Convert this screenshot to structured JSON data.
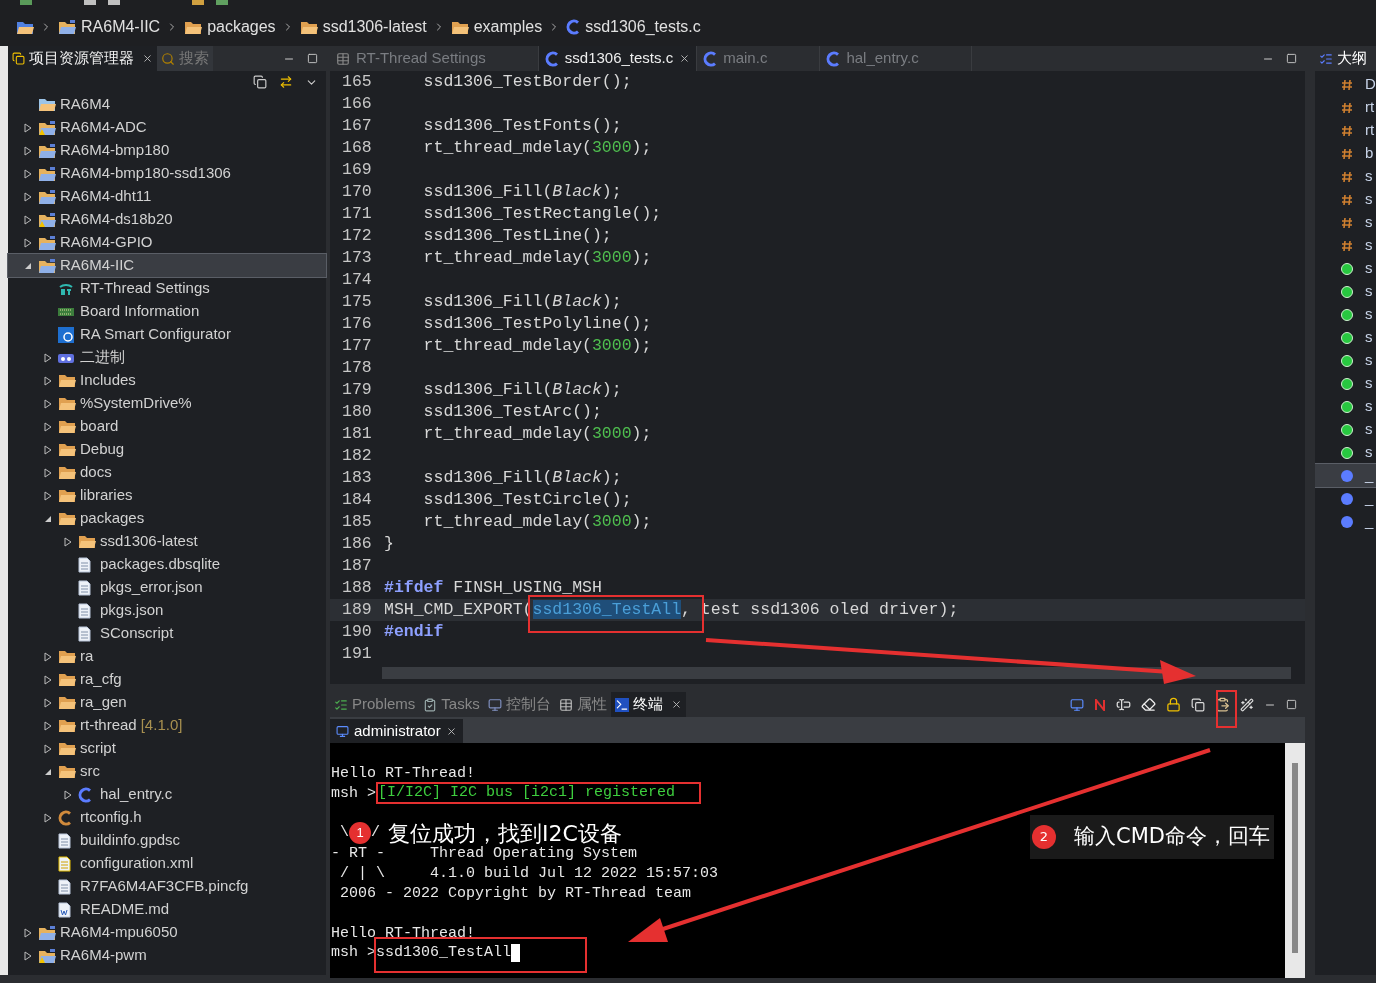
{
  "breadcrumb": [
    {
      "kind": "project",
      "text": "RA6M4-IIC"
    },
    {
      "kind": "folder",
      "text": "packages"
    },
    {
      "kind": "folder",
      "text": "ssd1306-latest"
    },
    {
      "kind": "folder",
      "text": "examples"
    },
    {
      "kind": "c-source",
      "text": "ssd1306_tests.c"
    }
  ],
  "explorer": {
    "tabs": [
      {
        "label": "项目资源管理器",
        "selected": true
      },
      {
        "label": "搜索",
        "selected": false
      }
    ],
    "tree": [
      {
        "kind": "folder-plain",
        "text": "RA6M4",
        "selected": false
      },
      {
        "kind": "project-warning",
        "text": "RA6M4-ADC",
        "expanded": false,
        "selected": false
      },
      {
        "kind": "project",
        "text": "RA6M4-bmp180",
        "expanded": false,
        "selected": false
      },
      {
        "kind": "project",
        "text": "RA6M4-bmp180-ssd1306",
        "expanded": false,
        "selected": false
      },
      {
        "kind": "project",
        "text": "RA6M4-dht11",
        "expanded": false,
        "selected": false
      },
      {
        "kind": "project-warning",
        "text": "RA6M4-ds18b20",
        "expanded": false,
        "selected": false
      },
      {
        "kind": "project",
        "text": "RA6M4-GPIO",
        "expanded": false,
        "selected": false
      },
      {
        "kind": "project",
        "text": "RA6M4-IIC",
        "expanded": true,
        "selected": true,
        "children": [
          {
            "kind": "rt-settings",
            "text": "RT-Thread Settings",
            "selected": false
          },
          {
            "kind": "board-info",
            "text": "Board Information",
            "selected": false
          },
          {
            "kind": "ra-config",
            "text": "RA Smart Configurator",
            "selected": false
          },
          {
            "kind": "binary",
            "text": "二进制",
            "expanded": false,
            "selected": false
          },
          {
            "kind": "includes",
            "text": "Includes",
            "expanded": false,
            "selected": false
          },
          {
            "kind": "folder",
            "text": "%SystemDrive%",
            "expanded": false,
            "selected": false
          },
          {
            "kind": "folder",
            "text": "board",
            "expanded": false,
            "selected": false
          },
          {
            "kind": "folder",
            "text": "Debug",
            "expanded": false,
            "selected": false
          },
          {
            "kind": "folder",
            "text": "docs",
            "expanded": false,
            "selected": false
          },
          {
            "kind": "folder",
            "text": "libraries",
            "expanded": false,
            "selected": false
          },
          {
            "kind": "folder",
            "text": "packages",
            "expanded": true,
            "selected": false,
            "children": [
              {
                "kind": "folder",
                "text": "ssd1306-latest",
                "expanded": false,
                "selected": false
              },
              {
                "kind": "file",
                "text": "packages.dbsqlite",
                "selected": false
              },
              {
                "kind": "file",
                "text": "pkgs_error.json",
                "selected": false
              },
              {
                "kind": "file",
                "text": "pkgs.json",
                "selected": false
              },
              {
                "kind": "file",
                "text": "SConscript",
                "selected": false
              }
            ]
          },
          {
            "kind": "folder",
            "text": "ra",
            "expanded": false,
            "selected": false
          },
          {
            "kind": "folder",
            "text": "ra_cfg",
            "expanded": false,
            "selected": false
          },
          {
            "kind": "folder",
            "text": "ra_gen",
            "expanded": false,
            "selected": false
          },
          {
            "kind": "folder",
            "text": "rt-thread",
            "suffix": "[4.1.0]",
            "expanded": false,
            "selected": false
          },
          {
            "kind": "folder",
            "text": "script",
            "expanded": false,
            "selected": false
          },
          {
            "kind": "folder",
            "text": "src",
            "expanded": true,
            "selected": false,
            "children": [
              {
                "kind": "c-source",
                "text": "hal_entry.c",
                "expanded": false,
                "selected": false
              }
            ]
          },
          {
            "kind": "c-header",
            "text": "rtconfig.h",
            "expanded": false,
            "selected": false
          },
          {
            "kind": "file",
            "text": "buildinfo.gpdsc",
            "selected": false
          },
          {
            "kind": "xml",
            "text": "configuration.xml",
            "selected": false
          },
          {
            "kind": "file",
            "text": "R7FA6M4AF3CFB.pincfg",
            "selected": false
          },
          {
            "kind": "word-doc",
            "text": "README.md",
            "selected": false
          }
        ]
      },
      {
        "kind": "project",
        "text": "RA6M4-mpu6050",
        "expanded": false,
        "selected": false
      },
      {
        "kind": "project-warning",
        "text": "RA6M4-pwm",
        "expanded": false,
        "selected": false
      }
    ]
  },
  "editor": {
    "tabs": [
      {
        "kind": "settings",
        "label": "RT-Thread Settings",
        "selected": false
      },
      {
        "kind": "c-source",
        "label": "ssd1306_tests.c",
        "selected": true
      },
      {
        "kind": "c-source",
        "label": "main.c",
        "selected": false
      },
      {
        "kind": "c-source",
        "label": "hal_entry.c",
        "selected": false
      }
    ],
    "lines": [
      {
        "num": "165",
        "current": false,
        "tokens": [
          {
            "kind": "plain",
            "text": "    ssd1306_TestBorder();"
          }
        ]
      },
      {
        "num": "166",
        "current": false
      },
      {
        "num": "167",
        "current": false,
        "tokens": [
          {
            "kind": "plain",
            "text": "    ssd1306_TestFonts();"
          }
        ]
      },
      {
        "num": "168",
        "current": false,
        "tokens": [
          {
            "kind": "plain",
            "text": "    rt_thread_mdelay("
          },
          {
            "kind": "number",
            "text": "3000"
          },
          {
            "kind": "plain",
            "text": ");"
          }
        ]
      },
      {
        "num": "169",
        "current": false
      },
      {
        "num": "170",
        "current": false,
        "tokens": [
          {
            "kind": "plain",
            "text": "    ssd1306_Fill("
          },
          {
            "kind": "constant",
            "text": "Black"
          },
          {
            "kind": "plain",
            "text": ");"
          }
        ]
      },
      {
        "num": "171",
        "current": false,
        "tokens": [
          {
            "kind": "plain",
            "text": "    ssd1306_TestRectangle();"
          }
        ]
      },
      {
        "num": "172",
        "current": false,
        "tokens": [
          {
            "kind": "plain",
            "text": "    ssd1306_TestLine();"
          }
        ]
      },
      {
        "num": "173",
        "current": false,
        "tokens": [
          {
            "kind": "plain",
            "text": "    rt_thread_mdelay("
          },
          {
            "kind": "number",
            "text": "3000"
          },
          {
            "kind": "plain",
            "text": ");"
          }
        ]
      },
      {
        "num": "174",
        "current": false
      },
      {
        "num": "175",
        "current": false,
        "tokens": [
          {
            "kind": "plain",
            "text": "    ssd1306_Fill("
          },
          {
            "kind": "constant",
            "text": "Black"
          },
          {
            "kind": "plain",
            "text": ");"
          }
        ]
      },
      {
        "num": "176",
        "current": false,
        "tokens": [
          {
            "kind": "plain",
            "text": "    ssd1306_TestPolyline();"
          }
        ]
      },
      {
        "num": "177",
        "current": false,
        "tokens": [
          {
            "kind": "plain",
            "text": "    rt_thread_mdelay("
          },
          {
            "kind": "number",
            "text": "3000"
          },
          {
            "kind": "plain",
            "text": ");"
          }
        ]
      },
      {
        "num": "178",
        "current": false
      },
      {
        "num": "179",
        "current": false,
        "tokens": [
          {
            "kind": "plain",
            "text": "    ssd1306_Fill("
          },
          {
            "kind": "constant",
            "text": "Black"
          },
          {
            "kind": "plain",
            "text": ");"
          }
        ]
      },
      {
        "num": "180",
        "current": false,
        "tokens": [
          {
            "kind": "plain",
            "text": "    ssd1306_TestArc();"
          }
        ]
      },
      {
        "num": "181",
        "current": false,
        "tokens": [
          {
            "kind": "plain",
            "text": "    rt_thread_mdelay("
          },
          {
            "kind": "number",
            "text": "3000"
          },
          {
            "kind": "plain",
            "text": ");"
          }
        ]
      },
      {
        "num": "182",
        "current": false
      },
      {
        "num": "183",
        "current": false,
        "tokens": [
          {
            "kind": "plain",
            "text": "    ssd1306_Fill("
          },
          {
            "kind": "constant",
            "text": "Black"
          },
          {
            "kind": "plain",
            "text": ");"
          }
        ]
      },
      {
        "num": "184",
        "current": false,
        "tokens": [
          {
            "kind": "plain",
            "text": "    ssd1306_TestCircle();"
          }
        ]
      },
      {
        "num": "185",
        "current": false,
        "tokens": [
          {
            "kind": "plain",
            "text": "    rt_thread_mdelay("
          },
          {
            "kind": "number",
            "text": "3000"
          },
          {
            "kind": "plain",
            "text": ");"
          }
        ]
      },
      {
        "num": "186",
        "current": false,
        "tokens": [
          {
            "kind": "plain",
            "text": "}"
          }
        ]
      },
      {
        "num": "187",
        "current": false
      },
      {
        "num": "188",
        "current": false,
        "tokens": [
          {
            "kind": "keyword",
            "text": "#ifdef"
          },
          {
            "kind": "plain",
            "text": " FINSH_USING_MSH"
          }
        ]
      },
      {
        "num": "189",
        "current": true,
        "tokens": [
          {
            "kind": "plain",
            "text": "MSH_CMD_EXPORT("
          },
          {
            "kind": "selection",
            "text": "ssd1306_TestAll"
          },
          {
            "kind": "plain",
            "text": ", test ssd1306 oled driver);"
          }
        ]
      },
      {
        "num": "190",
        "current": false,
        "tokens": [
          {
            "kind": "keyword",
            "text": "#endif"
          }
        ]
      },
      {
        "num": "191",
        "current": false
      }
    ]
  },
  "outline": {
    "title": "大纲",
    "items": [
      {
        "kind": "macro",
        "text": "D",
        "selected": false
      },
      {
        "kind": "macro",
        "text": "rt",
        "selected": false
      },
      {
        "kind": "macro",
        "text": "rt",
        "selected": false
      },
      {
        "kind": "macro",
        "text": "b",
        "selected": false
      },
      {
        "kind": "macro",
        "text": "s",
        "selected": false
      },
      {
        "kind": "macro",
        "text": "s",
        "selected": false
      },
      {
        "kind": "macro",
        "text": "s",
        "selected": false
      },
      {
        "kind": "macro",
        "text": "s",
        "selected": false
      },
      {
        "kind": "function",
        "text": "s",
        "selected": false
      },
      {
        "kind": "function",
        "text": "s",
        "selected": false
      },
      {
        "kind": "function",
        "text": "s",
        "selected": false
      },
      {
        "kind": "function",
        "text": "s",
        "selected": false
      },
      {
        "kind": "function",
        "text": "s",
        "selected": false
      },
      {
        "kind": "function",
        "text": "s",
        "selected": false
      },
      {
        "kind": "function",
        "text": "s",
        "selected": false
      },
      {
        "kind": "function",
        "text": "s",
        "selected": false
      },
      {
        "kind": "function",
        "text": "s",
        "selected": false
      },
      {
        "kind": "variable",
        "text": "_",
        "selected": true
      },
      {
        "kind": "variable",
        "text": "_",
        "selected": false
      },
      {
        "kind": "variable",
        "text": "_",
        "selected": false
      }
    ]
  },
  "bottom_panel": {
    "tabs": [
      {
        "kind": "problems",
        "label": "Problems",
        "selected": false
      },
      {
        "kind": "tasks",
        "label": "Tasks",
        "selected": false
      },
      {
        "kind": "console",
        "label": "控制台",
        "selected": false
      },
      {
        "kind": "properties",
        "label": "属性",
        "selected": false
      },
      {
        "kind": "terminal",
        "label": "终端",
        "selected": true
      }
    ],
    "session_tab": "administrator",
    "terminal_lines": [
      {
        "kind": "blank"
      },
      {
        "kind": "text",
        "text": "Hello RT-Thread!"
      },
      {
        "kind": "log",
        "prompt": "msh >",
        "text": "[I/I2C] I2C bus [i2c1] registered"
      },
      {
        "kind": "blank"
      },
      {
        "kind": "split",
        "left": " \\",
        "right": "/"
      },
      {
        "kind": "text",
        "text": "- RT -     Thread Operating System"
      },
      {
        "kind": "text",
        "text": " / | \\     4.1.0 build Jul 12 2022 15:57:03"
      },
      {
        "kind": "text",
        "text": " 2006 - 2022 Copyright by RT-Thread team"
      },
      {
        "kind": "blank"
      },
      {
        "kind": "text",
        "text": "Hello RT-Thread!"
      },
      {
        "kind": "input",
        "prompt": "msh >",
        "text": "ssd1306_TestAll"
      }
    ]
  },
  "annotations": [
    {
      "number": "1",
      "text": "复位成功，找到I2C设备"
    },
    {
      "number": "2",
      "text": "输入CMD命令，回车"
    }
  ]
}
